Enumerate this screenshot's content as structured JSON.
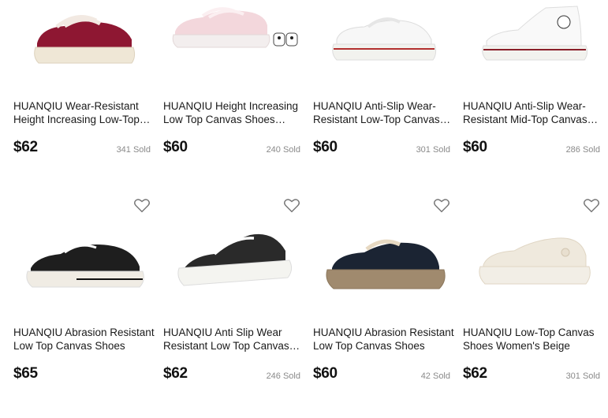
{
  "products": [
    {
      "title": "HUANQIU Wear-Resistant Height Increasing Low-Top Canvas Shoes",
      "price": "$62",
      "sold": "341 Sold",
      "upper_color": "#8e1732",
      "sole_color": "#efe7d6"
    },
    {
      "title": "HUANQIU Height Increasing Low Top Canvas Shoes Women's",
      "price": "$60",
      "sold": "240 Sold",
      "upper_color": "#f3d7dc",
      "sole_color": "#f3eeee"
    },
    {
      "title": "HUANQIU Anti-Slip Wear-Resistant Low-Top Canvas Shoes",
      "price": "$60",
      "sold": "301 Sold",
      "upper_color": "#f7f7f7",
      "sole_color": "#f2f2ee"
    },
    {
      "title": "HUANQIU Anti-Slip Wear-Resistant Mid-Top Canvas Shoes",
      "price": "$60",
      "sold": "286 Sold",
      "upper_color": "#f9f9f9",
      "sole_color": "#f2f2ee"
    },
    {
      "title": "HUANQIU Abrasion Resistant Low Top Canvas Shoes",
      "price": "$65",
      "sold": "",
      "upper_color": "#1e1e1e",
      "sole_color": "#f0ece4"
    },
    {
      "title": "HUANQIU Anti Slip Wear Resistant Low Top Canvas Shoes",
      "price": "$62",
      "sold": "246 Sold",
      "upper_color": "#2a2a2a",
      "sole_color": "#f4f4f0"
    },
    {
      "title": "HUANQIU Abrasion Resistant Low Top Canvas Shoes",
      "price": "$60",
      "sold": "42 Sold",
      "upper_color": "#1b2433",
      "sole_color": "#a08a6e"
    },
    {
      "title": "HUANQIU Low-Top Canvas Shoes Women's Beige",
      "price": "$62",
      "sold": "301 Sold",
      "upper_color": "#efe9dd",
      "sole_color": "#f2eee6"
    }
  ],
  "icons": {
    "favorite": "heart-outline-icon"
  }
}
